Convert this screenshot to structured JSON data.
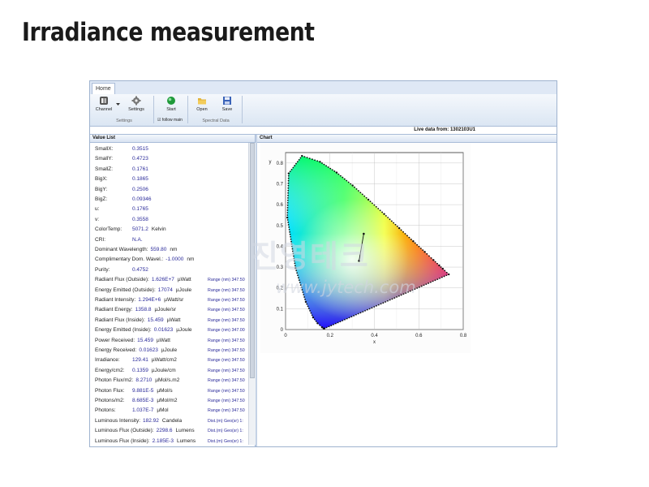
{
  "slide": {
    "title": "Irradiance measurement"
  },
  "app": {
    "tabs": [
      {
        "label": "Home"
      }
    ],
    "ribbon": {
      "channel": "Channel",
      "settings": "Settings",
      "settings_group": "Settings",
      "start": "Start",
      "follow_main": "follow main",
      "follow_check": "☑",
      "open": "Open",
      "save": "Save",
      "spectral_group": "Spectral Data"
    },
    "live_data": "Live data from: 1302103U1",
    "value_list": {
      "title": "Value List",
      "rows": [
        {
          "label": "SmallX:",
          "value": "0.3515",
          "unit": "",
          "range": ""
        },
        {
          "label": "SmallY:",
          "value": "0.4723",
          "unit": "",
          "range": ""
        },
        {
          "label": "SmallZ:",
          "value": "0.1761",
          "unit": "",
          "range": ""
        },
        {
          "label": "BigX:",
          "value": "0.1865",
          "unit": "",
          "range": ""
        },
        {
          "label": "BigY:",
          "value": "0.2506",
          "unit": "",
          "range": ""
        },
        {
          "label": "BigZ:",
          "value": "0.09346",
          "unit": "",
          "range": ""
        },
        {
          "label": "u:",
          "value": "0.1765",
          "unit": "",
          "range": ""
        },
        {
          "label": "v:",
          "value": "0.3558",
          "unit": "",
          "range": ""
        },
        {
          "label": "ColorTemp:",
          "value": "5071.2",
          "unit": "Kelvin",
          "range": ""
        },
        {
          "label": "CRI:",
          "value": "N.A.",
          "unit": "",
          "range": ""
        },
        {
          "label": "Dominant Wavelength:",
          "value": "559.80",
          "unit": "nm",
          "range": ""
        },
        {
          "label": "Complimentary Dom. Wavel.:",
          "value": "-1.0000",
          "unit": "nm",
          "range": ""
        },
        {
          "label": "Purity:",
          "value": "0.4752",
          "unit": "",
          "range": ""
        },
        {
          "label": "Radiant Flux (Outside):",
          "value": "1.626E+7",
          "unit": "µWatt",
          "range": "Range (nm) 347.50"
        },
        {
          "label": "Energy Emitted (Outside):",
          "value": "17074",
          "unit": "µJoule",
          "range": "Range (nm) 347.50"
        },
        {
          "label": "Radiant Intensity:",
          "value": "1.294E+6",
          "unit": "µWatt/sr",
          "range": "Range (nm) 347.50"
        },
        {
          "label": "Radiant Energy:",
          "value": "1358.8",
          "unit": "µJoule/sr",
          "range": "Range (nm) 347.50"
        },
        {
          "label": "Radiant Flux (Inside):",
          "value": "15.459",
          "unit": "µWatt",
          "range": "Range (nm) 347.50"
        },
        {
          "label": "Energy Emitted (Inside):",
          "value": "0.01623",
          "unit": "µJoule",
          "range": "Range (nm) 347.00"
        },
        {
          "label": "Power Received:",
          "value": "15.459",
          "unit": "µWatt",
          "range": "Range (nm) 347.50"
        },
        {
          "label": "Energy Received:",
          "value": "0.01623",
          "unit": "µJoule",
          "range": "Range (nm) 347.50"
        },
        {
          "label": "Irradiance:",
          "value": "129.41",
          "unit": "µWatt/cm2",
          "range": "Range (nm) 347.50"
        },
        {
          "label": "Energy/cm2:",
          "value": "0.1359",
          "unit": "µJoule/cm",
          "range": "Range (nm) 347.50"
        },
        {
          "label": "Photon Flux/m2:",
          "value": "8.2710",
          "unit": "µMol/s.m2",
          "range": "Range (nm) 347.50"
        },
        {
          "label": "Photon Flux:",
          "value": "9.881E-5",
          "unit": "µMol/s",
          "range": "Range (nm) 347.50"
        },
        {
          "label": "Photons/m2:",
          "value": "8.685E-3",
          "unit": "µMol/m2",
          "range": "Range (nm) 347.50"
        },
        {
          "label": "Photons:",
          "value": "1.037E-7",
          "unit": "µMol",
          "range": "Range (nm) 347.50"
        },
        {
          "label": "Luminous Intensity:",
          "value": "182.92",
          "unit": "Candela",
          "range": "Dist.(m) Geo(sr) 1:"
        },
        {
          "label": "Luminous Flux (Outside):",
          "value": "2298.6",
          "unit": "Lumens",
          "range": "Dist.(m) Geo(sr) 1:"
        },
        {
          "label": "Luminous Flux (Inside):",
          "value": "2.185E-3",
          "unit": "Lumens",
          "range": "Dist.(m) Geo(sr) 1:"
        }
      ]
    },
    "chart": {
      "title": "Chart",
      "chart_data": {
        "type": "scatter",
        "xlabel": "x",
        "ylabel": "y",
        "xlim": [
          0,
          0.8
        ],
        "ylim": [
          0,
          0.85
        ],
        "xticks": [
          "0",
          "0.2",
          "0.4",
          "0.6",
          "0.8"
        ],
        "yticks": [
          "0",
          "0.1",
          "0.2",
          "0.3",
          "0.4",
          "0.5",
          "0.6",
          "0.7",
          "0.8"
        ],
        "grid": true,
        "locus": [
          [
            0.175,
            0.005
          ],
          [
            0.174,
            0.005
          ],
          [
            0.171,
            0.005
          ],
          [
            0.164,
            0.011
          ],
          [
            0.144,
            0.03
          ],
          [
            0.124,
            0.058
          ],
          [
            0.091,
            0.133
          ],
          [
            0.045,
            0.295
          ],
          [
            0.008,
            0.538
          ],
          [
            0.014,
            0.75
          ],
          [
            0.074,
            0.834
          ],
          [
            0.155,
            0.806
          ],
          [
            0.23,
            0.754
          ],
          [
            0.302,
            0.692
          ],
          [
            0.373,
            0.624
          ],
          [
            0.444,
            0.555
          ],
          [
            0.512,
            0.487
          ],
          [
            0.575,
            0.424
          ],
          [
            0.627,
            0.373
          ],
          [
            0.666,
            0.334
          ],
          [
            0.692,
            0.308
          ],
          [
            0.708,
            0.292
          ],
          [
            0.735,
            0.265
          ]
        ],
        "measurement_line": [
          [
            0.331,
            0.33
          ],
          [
            0.352,
            0.46
          ]
        ]
      }
    },
    "watermark": {
      "korean": "진영테크",
      "url": "www.jytech.com"
    }
  }
}
